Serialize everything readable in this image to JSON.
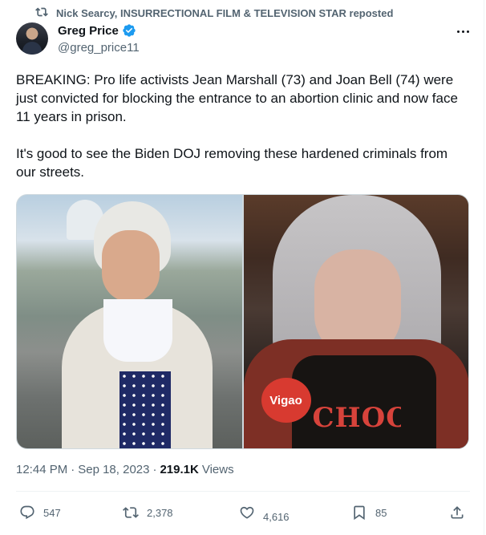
{
  "repost": {
    "icon": "repost-icon",
    "text": "Nick Searcy, INSURRECTIONAL FILM & TELEVISION STAR reposted"
  },
  "author": {
    "name": "Greg Price",
    "handle": "@greg_price11",
    "verified": true,
    "verified_color": "#1d9bf0"
  },
  "tweet": {
    "paragraphs": [
      "BREAKING: Pro life activists Jean Marshall (73) and Joan Bell (74) were just convicted for blocking the entrance to an abortion clinic and now face 11 years in prison.",
      "It's good to see the Biden DOJ removing these hardened criminals from our streets."
    ]
  },
  "media": {
    "right_badge": "Vigao",
    "right_shirt_text": "CHOO"
  },
  "meta": {
    "time": "12:44 PM",
    "separator": "·",
    "date": "Sep 18, 2023",
    "views_count": "219.1K",
    "views_label": "Views"
  },
  "actions": {
    "replies": "547",
    "reposts": "2,378",
    "likes": "4,616",
    "bookmarks": "85"
  },
  "colors": {
    "text": "#0f1419",
    "secondary": "#536471",
    "border": "#cfd9de",
    "accent": "#1d9bf0"
  }
}
